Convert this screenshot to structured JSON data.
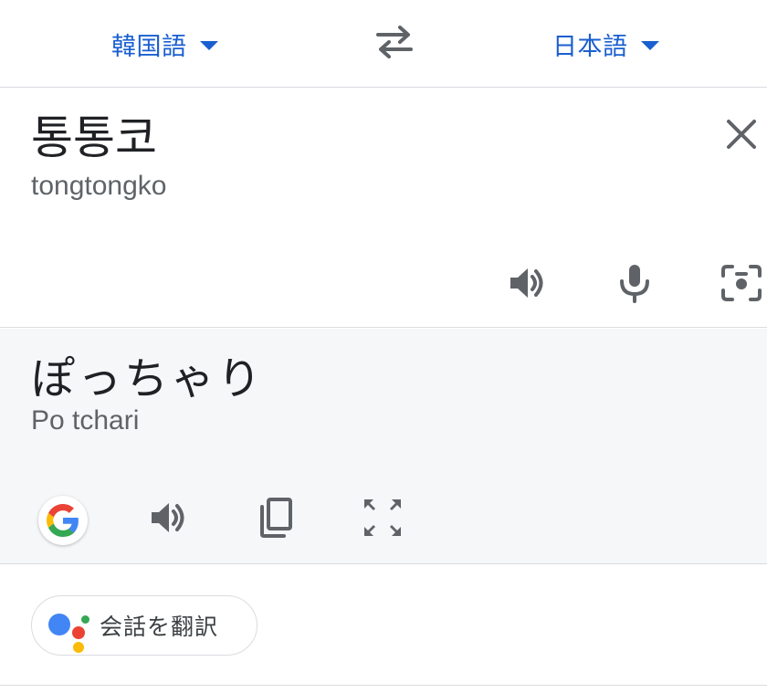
{
  "languages": {
    "source": "韓国語",
    "target": "日本語"
  },
  "source_panel": {
    "text": "통통코",
    "transliteration": "tongtongko"
  },
  "result_panel": {
    "text": "ぽっちゃり",
    "transliteration": "Po tchari"
  },
  "conversation": {
    "label": "会話を翻訳"
  },
  "icons": {
    "swap": "swap-languages-icon",
    "close": "close-icon",
    "speaker": "speaker-icon",
    "mic": "microphone-icon",
    "camera": "camera-icon",
    "google": "google-icon",
    "copy": "copy-icon",
    "fullscreen": "fullscreen-icon",
    "assistant": "assistant-icon"
  },
  "colors": {
    "accent": "#1a5fd0",
    "icon_gray": "#5f6368",
    "result_bg": "#f5f7f9"
  }
}
